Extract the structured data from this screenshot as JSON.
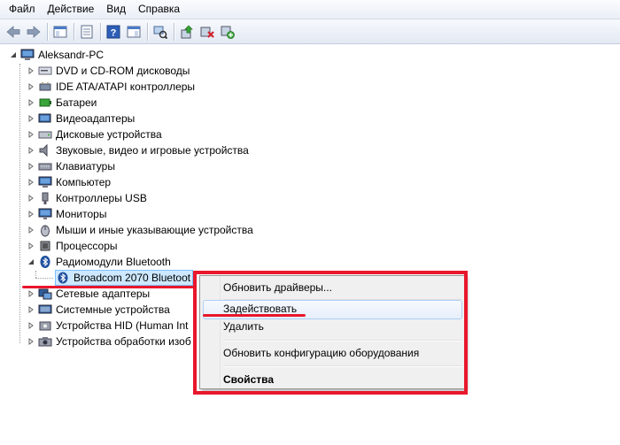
{
  "menubar": {
    "items": [
      "Файл",
      "Действие",
      "Вид",
      "Справка"
    ]
  },
  "toolbar": {
    "icons": [
      "back-arrow-icon",
      "forward-arrow-icon",
      "show-hide-console-tree-icon",
      "properties-icon",
      "help-icon",
      "action-pane-icon",
      "scan-hardware-icon",
      "update-driver-icon",
      "uninstall-device-icon",
      "enable-device-icon"
    ]
  },
  "tree": {
    "root": "Aleksandr-PC",
    "categories": [
      {
        "label": "DVD и CD-ROM дисководы",
        "icon": "dvd-drive-icon"
      },
      {
        "label": "IDE ATA/ATAPI контроллеры",
        "icon": "ide-controller-icon"
      },
      {
        "label": "Батареи",
        "icon": "battery-icon"
      },
      {
        "label": "Видеоадаптеры",
        "icon": "display-adapter-icon"
      },
      {
        "label": "Дисковые устройства",
        "icon": "disk-drive-icon"
      },
      {
        "label": "Звуковые, видео и игровые устройства",
        "icon": "sound-device-icon"
      },
      {
        "label": "Клавиатуры",
        "icon": "keyboard-icon"
      },
      {
        "label": "Компьютер",
        "icon": "computer-icon"
      },
      {
        "label": "Контроллеры USB",
        "icon": "usb-controller-icon"
      },
      {
        "label": "Мониторы",
        "icon": "monitor-icon"
      },
      {
        "label": "Мыши и иные указывающие устройства",
        "icon": "mouse-icon"
      },
      {
        "label": "Процессоры",
        "icon": "processor-icon"
      },
      {
        "label": "Радиомодули Bluetooth",
        "icon": "bluetooth-icon"
      },
      {
        "label": "Сетевые адаптеры",
        "icon": "network-adapter-icon"
      },
      {
        "label": "Системные устройства",
        "icon": "system-device-icon"
      },
      {
        "label": "Устройства HID (Human Int",
        "icon": "hid-device-icon"
      },
      {
        "label": "Устройства обработки изоб",
        "icon": "imaging-device-icon"
      }
    ],
    "bluetooth_child": "Broadcom 2070 Bluetoot"
  },
  "context_menu": {
    "update_drivers": "Обновить драйверы...",
    "enable": "Задействовать",
    "delete": "Удалить",
    "scan_hardware": "Обновить конфигурацию оборудования",
    "properties": "Свойства"
  },
  "colors": {
    "highlight_red": "#e8172b",
    "selection": "#cde8ff"
  }
}
